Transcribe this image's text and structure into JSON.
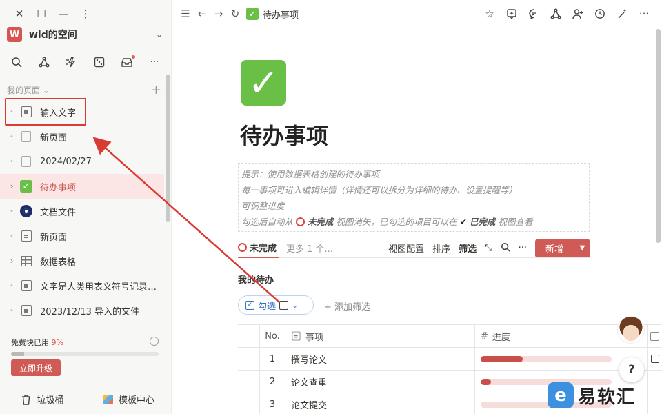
{
  "window": {
    "close": "✕",
    "maximize": "☐",
    "minimize": "—",
    "more": "⋮"
  },
  "space": {
    "avatar": "W",
    "name": "wid的空间"
  },
  "sidebar": {
    "section": "我的页面",
    "items": [
      {
        "label": "输入文字",
        "icon": "doc-icon"
      },
      {
        "label": "新页面",
        "icon": "blank-page-icon"
      },
      {
        "label": "2024/02/27",
        "icon": "blank-page-icon"
      },
      {
        "label": "待办事项",
        "icon": "check-icon"
      },
      {
        "label": "文档文件",
        "icon": "eye-icon"
      },
      {
        "label": "新页面",
        "icon": "doc-icon"
      },
      {
        "label": "数据表格",
        "icon": "table-icon"
      },
      {
        "label": "文字是人类用表义符号记录…",
        "icon": "doc-icon"
      },
      {
        "label": "2023/12/13 导入的文件",
        "icon": "doc-icon"
      }
    ],
    "quota_label": "免费块已用",
    "quota_pct": "9%",
    "quota_fraction": 0.09,
    "upgrade": "立即升级",
    "trash": "垃圾桶",
    "templates": "模板中心"
  },
  "topbar": {
    "crumb": "待办事项"
  },
  "page": {
    "title": "待办事项",
    "callout": {
      "line1": "提示：使用数据表格创建的待办事项",
      "line2": "每一事项可进入编辑详情（详情还可以拆分为详细的待办、设置提醒等）",
      "line3": "可调整进度",
      "line4_a": "勾选后自动从",
      "line4_b": "未完成",
      "line4_c": "视图消失，已勾选的项目可以在",
      "line4_d": "已完成",
      "line4_e": "视图查看"
    }
  },
  "views": {
    "active": "未完成",
    "more": "更多 1 个...",
    "config": "视图配置",
    "sort": "排序",
    "filter": "筛选",
    "new": "新增"
  },
  "db": {
    "title": "我的待办",
    "filter_chip": "勾选",
    "add_filter": "添加筛选",
    "headers": {
      "no": "No.",
      "item": "事项",
      "progress": "进度"
    },
    "rows": [
      {
        "no": "1",
        "item": "撰写论文",
        "progress": 0.32
      },
      {
        "no": "2",
        "item": "论文查重",
        "progress": 0.08
      },
      {
        "no": "3",
        "item": "论文提交",
        "progress": 0
      }
    ]
  },
  "help": "?",
  "watermark": "易软汇"
}
